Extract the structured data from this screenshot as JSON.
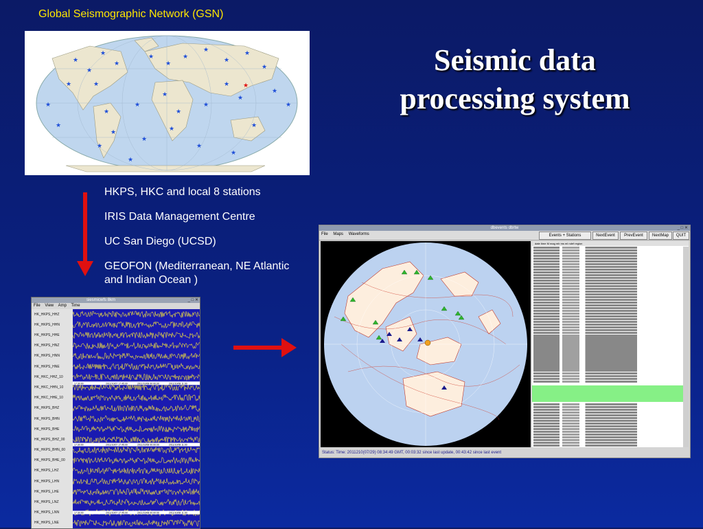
{
  "slide": {
    "gsn_title": "Global Seismographic Network (GSN)",
    "main_title_line1": "Seismic data",
    "main_title_line2": "processing system"
  },
  "stations": [
    "HKPS, HKC and local 8 stations",
    "IRIS Data Management Centre",
    "UC San Diego (UCSD)",
    "GEOFON (Mediterranean, NE Atlantic and Indian Ocean )"
  ],
  "colors": {
    "background": "#0a2080",
    "gsn_title": "#ffe600",
    "arrow": "#e01010",
    "station_star": "#1f4fd8",
    "waveform_bg": "#1a1ab0",
    "waveform_trace": "#f5e23a",
    "event_highlight": "#86f086"
  },
  "waveform_window": {
    "title": "siesmicwfs  8km",
    "menu": [
      "File",
      "View",
      "Amp",
      "Time"
    ],
    "channels": [
      "HK_HKPS_HHZ",
      "HK_HKPS_HHN",
      "HK_HKPS_HHE",
      "HK_HKPS_HNZ",
      "HK_HKPS_HNN",
      "HK_HKPS_HNE",
      "HK_HKC_HHZ_10",
      "HK_HKC_HHN_10",
      "HK_HKC_HHE_10",
      "HK_HKPS_BHZ",
      "HK_HKPS_BHN",
      "HK_HKPS_BHE",
      "HK_HKPS_BHZ_00",
      "HK_HKPS_BHN_00",
      "HK_HKPS_BHE_00",
      "HK_HKPS_LHZ",
      "HK_HKPS_LHN",
      "HK_HKPS_LHE",
      "HK_HKPS_LNZ",
      "HK_HKPS_LNN",
      "HK_HKPS_LNE"
    ],
    "time_labels": [
      "17:30:00",
      "2011/10/07 17:45:00",
      "2011/10/08 00:00:00",
      "2011/10/08 11:00"
    ]
  },
  "app_window": {
    "title": "dbevents dbrtw",
    "menu": [
      "File",
      "Maps",
      "Waveforms"
    ],
    "buttons": [
      "Events + Stations",
      "NextEvent",
      "PrevEvent",
      "NextMap",
      "QUIT"
    ],
    "event_header": "date        time  M  mag mb  ms  ml  ndef  region",
    "status": "Status: Time: 2011210(07/29) 08:34:49 GMT, 00:03:32 since last update, 00:43:42 since last event"
  }
}
